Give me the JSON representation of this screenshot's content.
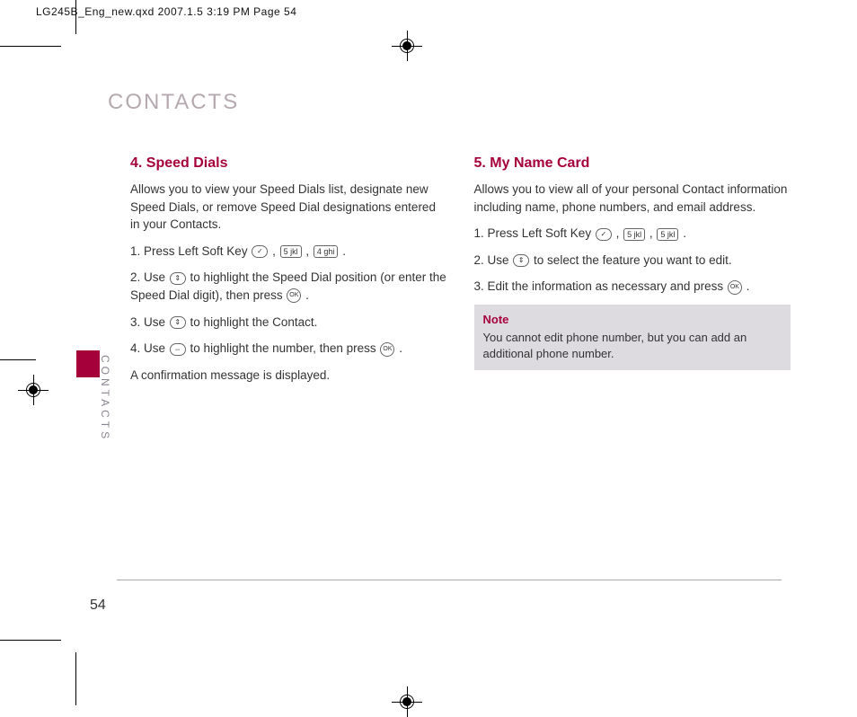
{
  "meta": {
    "header": "LG245B_Eng_new.qxd  2007.1.5  3:19 PM  Page 54"
  },
  "page": {
    "title": "CONTACTS",
    "side_label": "CONTACTS",
    "number": "54"
  },
  "keys": {
    "soft": "✓",
    "num5": "5 jkl",
    "num4": "4 ghi",
    "updown": "⇕",
    "leftright": "⇔",
    "ok": "OK"
  },
  "left": {
    "heading": "4. Speed Dials",
    "intro": "Allows you to view your Speed Dials list, designate new Speed Dials, or remove Speed Dial designations entered in your Contacts.",
    "s1a": "1. Press Left Soft Key ",
    "s1b": " , ",
    "s1c": " , ",
    "s1d": " .",
    "s2a": "2. Use ",
    "s2b": " to highlight the Speed Dial position (or enter the Speed Dial digit), then press ",
    "s2c": " .",
    "s3a": "3. Use ",
    "s3b": " to highlight the Contact.",
    "s4a": "4. Use ",
    "s4b": " to highlight the number, then press ",
    "s4c": " .",
    "s5": "A confirmation message is displayed."
  },
  "right": {
    "heading": "5. My Name Card",
    "intro": "Allows you to view all of your personal Contact information including name, phone numbers, and email address.",
    "s1a": "1. Press Left Soft Key ",
    "s1b": " , ",
    "s1c": " , ",
    "s1d": " .",
    "s2a": "2. Use ",
    "s2b": " to select the feature you want to edit.",
    "s3a": "3. Edit the information as necessary and press ",
    "s3b": " .",
    "note_title": "Note",
    "note_body": "You cannot edit phone number, but you can add an additional phone number."
  }
}
